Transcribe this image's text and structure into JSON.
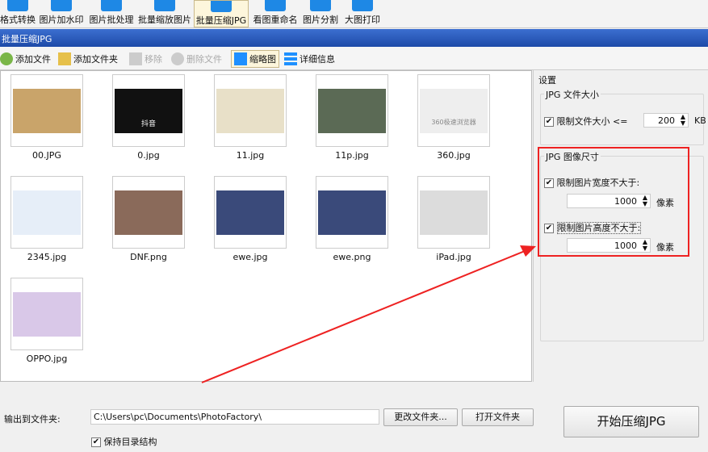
{
  "toolbar": {
    "items": [
      {
        "label": "格式转换"
      },
      {
        "label": "图片加水印"
      },
      {
        "label": "图片批处理"
      },
      {
        "label": "批量缩放图片"
      },
      {
        "label": "批量压缩JPG",
        "active": true
      },
      {
        "label": "看图重命名"
      },
      {
        "label": "图片分割"
      },
      {
        "label": "大图打印"
      }
    ]
  },
  "window_title": "批量压缩JPG",
  "actions": {
    "add_file": "添加文件",
    "add_folder": "添加文件夹",
    "remove": "移除",
    "delete_file": "删除文件",
    "thumbnail": "缩略图",
    "details": "详细信息"
  },
  "files": [
    {
      "name": "00.JPG",
      "color": "#c9a46a"
    },
    {
      "name": "0.jpg",
      "color": "#111111"
    },
    {
      "name": "11.jpg",
      "color": "#e8e0c8"
    },
    {
      "name": "11p.jpg",
      "color": "#5b6a55"
    },
    {
      "name": "360.jpg",
      "color": "#eeeeee"
    },
    {
      "name": "2345.jpg",
      "color": "#e6eef8"
    },
    {
      "name": "DNF.png",
      "color": "#8a6a5a"
    },
    {
      "name": "ewe.jpg",
      "color": "#3a4a7a"
    },
    {
      "name": "ewe.png",
      "color": "#3a4a7a"
    },
    {
      "name": "iPad.jpg",
      "color": "#dcdcdc"
    },
    {
      "name": "OPPO.jpg",
      "color": "#d9c8e8"
    }
  ],
  "thumb_text": {
    "douyin": "抖音",
    "browser360": "360极速浏览器"
  },
  "settings": {
    "header": "设置",
    "size_group": "JPG 文件大小",
    "limit_size_label": "限制文件大小 <=",
    "limit_size_checked": true,
    "size_value": "200",
    "size_unit": "KB",
    "dim_group": "JPG 图像尺寸",
    "limit_width_label": "限制图片宽度不大于:",
    "limit_width_checked": true,
    "width_value": "1000",
    "height_label": "限制图片高度不大于:",
    "limit_height_checked": true,
    "height_value": "1000",
    "pixel_unit": "像素"
  },
  "output": {
    "label": "输出到文件夹:",
    "path": "C:\\Users\\pc\\Documents\\PhotoFactory\\",
    "change_folder": "更改文件夹...",
    "open_folder": "打开文件夹",
    "keep_structure": "保持目录结构",
    "keep_structure_checked": true,
    "start": "开始压缩JPG"
  },
  "annotation_color": "#ee2222"
}
